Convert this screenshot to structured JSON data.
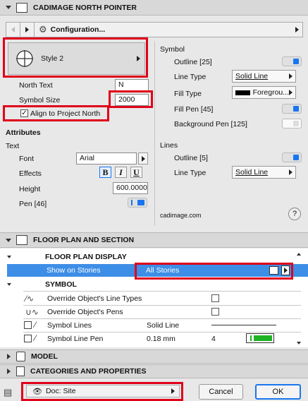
{
  "title": "CADIMAGE NORTH POINTER",
  "toolbar": {
    "config_label": "Configuration..."
  },
  "style": {
    "label": "Style 2"
  },
  "left": {
    "north_text_label": "North Text",
    "north_text_value": "N",
    "symbol_size_label": "Symbol Size",
    "symbol_size_value": "2000",
    "align_label": "Align to Project North",
    "attributes_label": "Attributes",
    "text_label": "Text",
    "font_label": "Font",
    "font_value": "Arial",
    "effects_label": "Effects",
    "effects": [
      "B",
      "I",
      "U"
    ],
    "height_label": "Height",
    "height_value": "600.0000",
    "pen_label": "Pen [46]"
  },
  "right": {
    "symbol_label": "Symbol",
    "outline_label": "Outline [25]",
    "line_type_label": "Line Type",
    "line_type_value": "Solid Line",
    "fill_type_label": "Fill Type",
    "fill_type_value": "Foregrou...",
    "fill_pen_label": "Fill Pen [45]",
    "bg_pen_label": "Background Pen [125]",
    "lines_label": "Lines",
    "lines_outline_label": "Outline [5]",
    "lines_line_type_label": "Line Type",
    "lines_line_type_value": "Solid Line",
    "credit": "cadimage.com",
    "help": "?"
  },
  "floor": {
    "section_title": "FLOOR PLAN AND SECTION",
    "display_label": "FLOOR PLAN DISPLAY",
    "show_label": "Show on Stories",
    "show_value": "All Stories",
    "symbol_label": "SYMBOL",
    "override_lt": "Override Object's Line Types",
    "override_pens": "Override Object's Pens",
    "symbol_lines": "Symbol Lines",
    "symbol_lines_value": "Solid Line",
    "symbol_line_pen": "Symbol Line Pen",
    "symbol_line_pen_value": "0.18 mm",
    "symbol_line_pen_num": "4"
  },
  "model_label": "MODEL",
  "categories_label": "CATEGORIES AND PROPERTIES",
  "footer": {
    "doc_label": "Doc: Site",
    "cancel": "Cancel",
    "ok": "OK"
  },
  "colors": {
    "accent": "#1976f0",
    "highlight": "#3d8ee6",
    "red": "#e0001a",
    "green": "#1db323"
  }
}
